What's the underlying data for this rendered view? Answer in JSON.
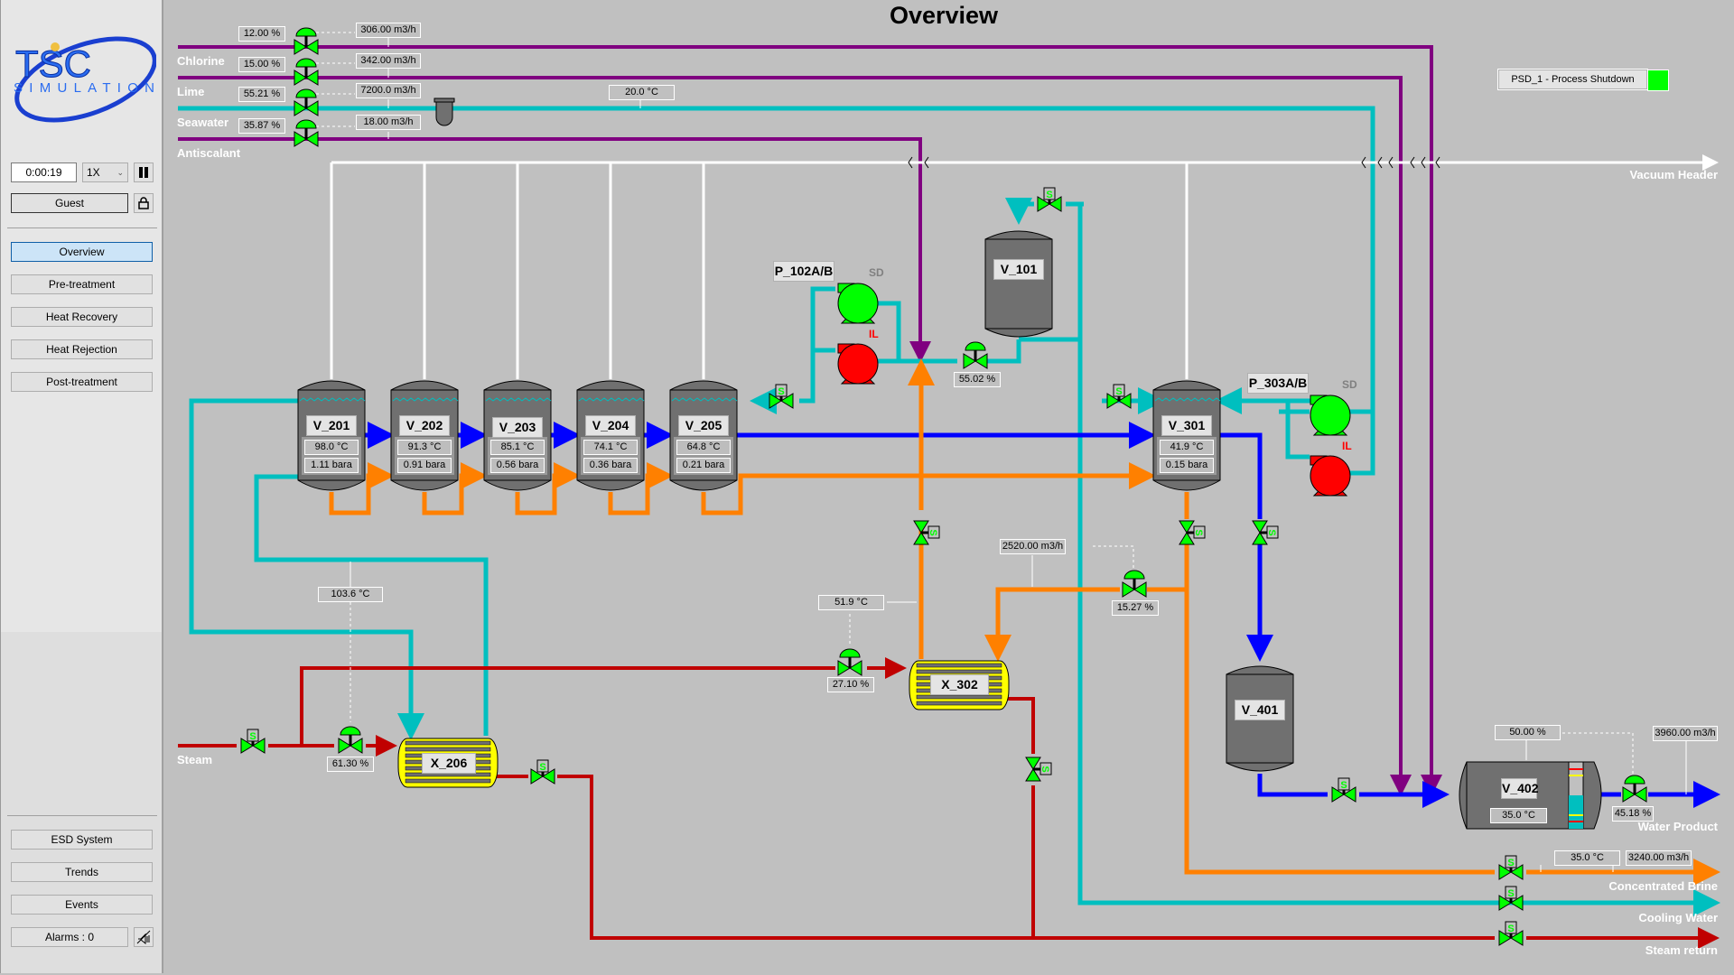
{
  "window": {
    "title": "Overview"
  },
  "sidebar": {
    "logo": {
      "line1": "TSC",
      "line2": "SIMULATION"
    },
    "sim_time": "0:00:19",
    "speed": "1X",
    "pause_icon": "pause-icon",
    "user": "Guest",
    "lock_icon": "lock-icon",
    "nav": [
      {
        "label": "Overview",
        "active": true
      },
      {
        "label": "Pre-treatment",
        "active": false
      },
      {
        "label": "Heat Recovery",
        "active": false
      },
      {
        "label": "Heat Rejection",
        "active": false
      },
      {
        "label": "Post-treatment",
        "active": false
      }
    ],
    "bottom": [
      {
        "label": "ESD System"
      },
      {
        "label": "Trends"
      },
      {
        "label": "Events"
      }
    ],
    "alarms": "Alarms : 0",
    "mute_icon": "alarm-mute-icon"
  },
  "psd": {
    "label": "PSD_1 - Process Shutdown",
    "status_color": "#00ff00"
  },
  "streams": {
    "chlorine": "Chlorine",
    "lime": "Lime",
    "seawater": "Seawater",
    "antiscalant": "Antiscalant",
    "vacuum_header": "Vacuum Header",
    "steam": "Steam",
    "water_product": "Water Product",
    "concentrated_brine": "Concentrated Brine",
    "cooling_water": "Cooling Water",
    "steam_return": "Steam return"
  },
  "dosing": [
    {
      "stream": "Chlorine",
      "valve_pct": "12.00 %",
      "flow": "306.00 m3/h"
    },
    {
      "stream": "Lime",
      "valve_pct": "15.00 %",
      "flow": "342.00 m3/h"
    },
    {
      "stream": "Seawater",
      "valve_pct": "55.21 %",
      "flow": "7200.0 m3/h"
    },
    {
      "stream": "Antiscalant",
      "valve_pct": "35.87 %",
      "flow": "18.00 m3/h"
    }
  ],
  "seawater_temp": "20.0 °C",
  "vessels": {
    "V_201": {
      "tag": "V_201",
      "temp": "98.0 °C",
      "press": "1.11 bara"
    },
    "V_202": {
      "tag": "V_202",
      "temp": "91.3 °C",
      "press": "0.91 bara"
    },
    "V_203": {
      "tag": "V_203",
      "temp": "85.1 °C",
      "press": "0.56 bara"
    },
    "V_204": {
      "tag": "V_204",
      "temp": "74.1 °C",
      "press": "0.36 bara"
    },
    "V_205": {
      "tag": "V_205",
      "temp": "64.8 °C",
      "press": "0.21 bara"
    },
    "V_301": {
      "tag": "V_301",
      "temp": "41.9 °C",
      "press": "0.15 bara"
    },
    "V_101": {
      "tag": "V_101"
    },
    "V_401": {
      "tag": "V_401"
    },
    "V_402": {
      "tag": "V_402",
      "temp": "35.0 °C",
      "level": "50.00 %",
      "level_fraction": 0.5
    }
  },
  "pumps": {
    "P_102": {
      "tag": "P_102A/B",
      "a_status": "SD",
      "b_status": "IL",
      "a_color": "#00ff00",
      "b_color": "#ff0000"
    },
    "P_303": {
      "tag": "P_303A/B",
      "a_status": "SD",
      "b_status": "IL",
      "a_color": "#00ff00",
      "b_color": "#ff0000"
    }
  },
  "exchangers": {
    "X_206": {
      "tag": "X_206"
    },
    "X_302": {
      "tag": "X_302"
    }
  },
  "readouts": {
    "v101_valve": "55.02 %",
    "x206_temp": "103.6 °C",
    "steam_valve": "61.30 %",
    "x302_temp": "51.9 °C",
    "x302_steam_valve": "27.10 %",
    "recycle_flow": "2520.00 m3/h",
    "recycle_valve": "15.27 %",
    "product_valve": "45.18 %",
    "product_flow": "3960.00 m3/h",
    "brine_temp": "35.0 °C",
    "brine_flow": "3240.00 m3/h"
  },
  "colors": {
    "seawater": "#00bfbf",
    "chemical": "#800080",
    "distillate": "#0000ff",
    "brine": "#ff8000",
    "steam": "#c00000",
    "vacuum": "#ffffff",
    "valve_open": "#00ff00"
  }
}
